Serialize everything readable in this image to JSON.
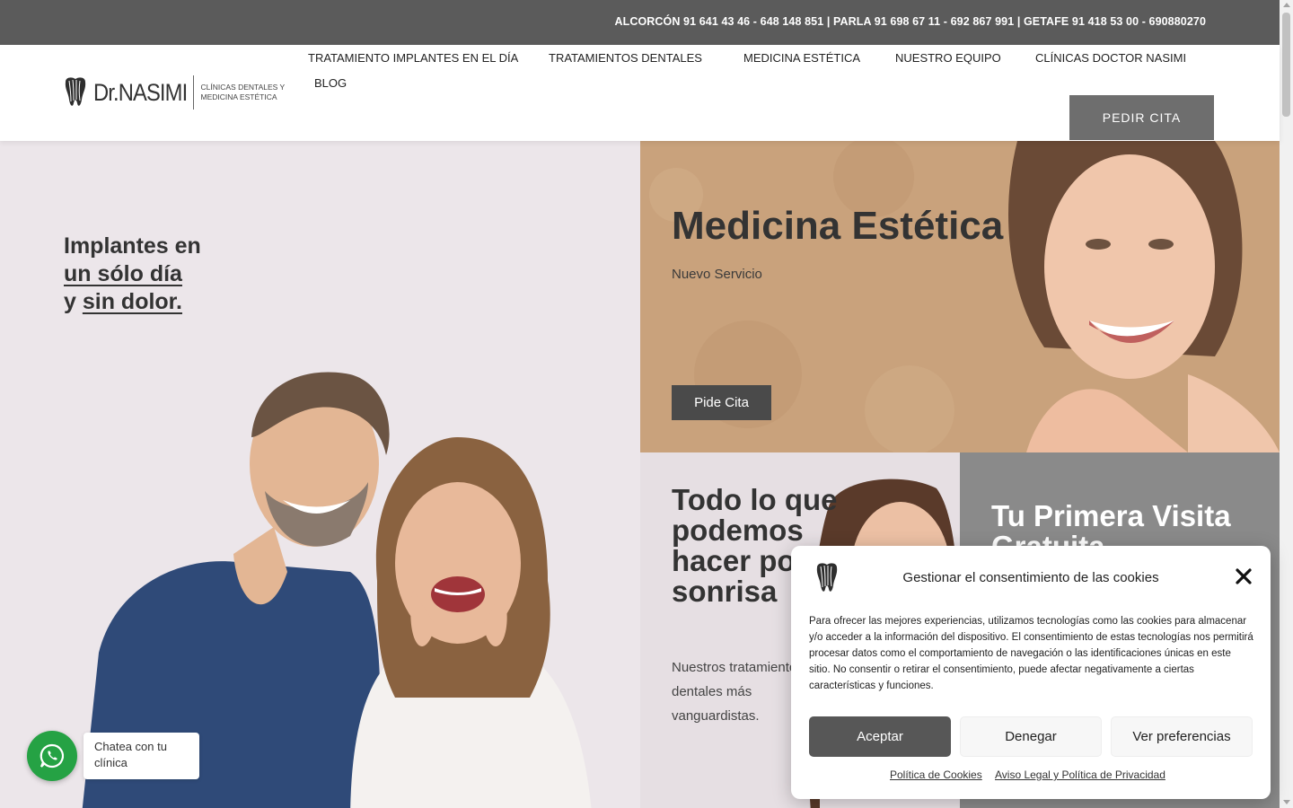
{
  "topbar": {
    "phones": "ALCORCÓN 91 641 43 46 - 648 148 851  |  PARLA 91 698 67 11 - 692 867 991 | GETAFE 91 418 53 00 - 690880270"
  },
  "header": {
    "logo_name": "Dr.NASIMI",
    "logo_tagline_1": "CLÍNICAS DENTALES Y",
    "logo_tagline_2": "MEDICINA ESTÉTICA",
    "nav": [
      {
        "label": "TRATAMIENTO IMPLANTES EN EL DÍA"
      },
      {
        "label": "TRATAMIENTOS DENTALES"
      },
      {
        "label": "MEDICINA ESTÉTICA"
      },
      {
        "label": "NUESTRO EQUIPO"
      },
      {
        "label": "CLÍNICAS DOCTOR NASIMI"
      },
      {
        "label": "BLOG"
      }
    ],
    "cta": "PEDIR CITA"
  },
  "hero": {
    "line1": "Implantes en",
    "line2": "un sólo día",
    "line3_prefix": "y ",
    "line3_link": "sin dolor."
  },
  "medicina": {
    "title": "Medicina Estética",
    "subtitle": "Nuevo Servicio",
    "button": "Pide Cita"
  },
  "smile": {
    "title": "Todo lo que podemos hacer por tu sonrisa",
    "description": "Nuestros tratamientos dentales más vanguardistas."
  },
  "visit": {
    "title": "Tu Primera Visita Gratuita"
  },
  "whatsapp": {
    "label": "Chatea con tu clínica"
  },
  "cookie": {
    "title": "Gestionar el consentimiento de las cookies",
    "text": "Para ofrecer las mejores experiencias, utilizamos tecnologías como las cookies para almacenar y/o acceder a la información del dispositivo. El consentimiento de estas tecnologías nos permitirá procesar datos como el comportamiento de navegación o las identificaciones únicas en este sitio. No consentir o retirar el consentimiento, puede afectar negativamente a ciertas características y funciones.",
    "accept": "Aceptar",
    "deny": "Denegar",
    "preferences": "Ver preferencias",
    "link_cookies": "Política de Cookies",
    "link_legal": "Aviso Legal y Política de Privacidad"
  },
  "colors": {
    "topbar": "#5b5b5b",
    "accent_button": "#575757",
    "whatsapp": "#25a244",
    "med_background": "#c9a27c"
  },
  "icons": [
    "tooth-logo-icon",
    "whatsapp-icon",
    "close-icon"
  ]
}
